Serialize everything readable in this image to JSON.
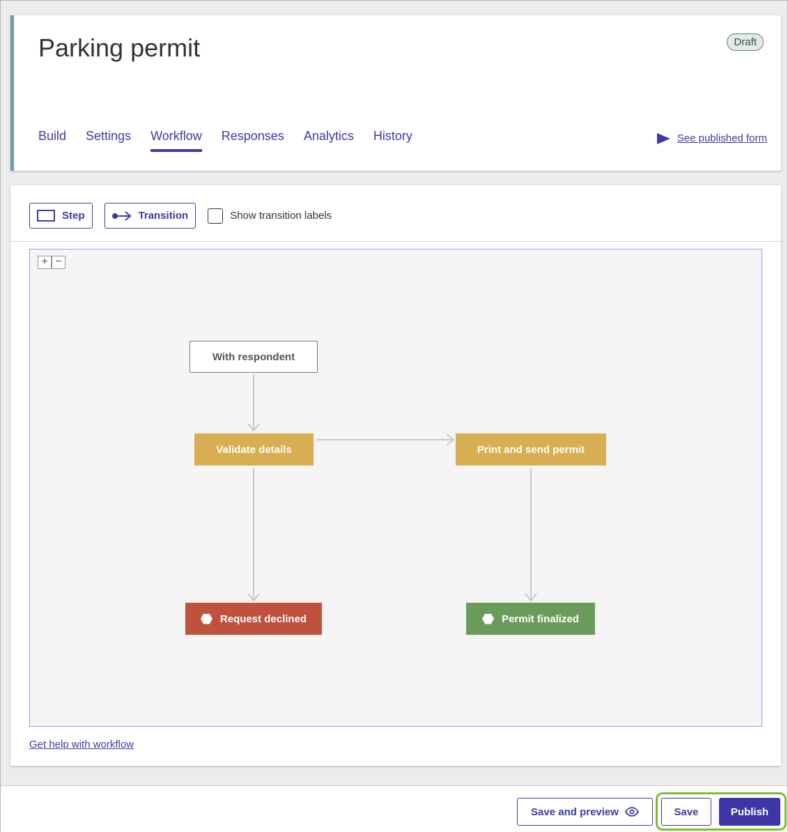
{
  "header": {
    "title": "Parking permit",
    "status": "Draft",
    "tabs": [
      {
        "label": "Build"
      },
      {
        "label": "Settings"
      },
      {
        "label": "Workflow",
        "active": true
      },
      {
        "label": "Responses"
      },
      {
        "label": "Analytics"
      },
      {
        "label": "History"
      }
    ],
    "published_link": "See published form"
  },
  "toolbar": {
    "step_label": "Step",
    "transition_label": "Transition",
    "show_labels_text": "Show transition labels",
    "show_labels_checked": false
  },
  "zoom": {
    "in": "+",
    "out": "−"
  },
  "workflow": {
    "nodes": {
      "start": "With respondent",
      "validate": "Validate details",
      "print": "Print and send permit",
      "declined": "Request declined",
      "finalized": "Permit finalized"
    },
    "colors": {
      "step": "#d8ae52",
      "declined": "#c0513f",
      "finalized": "#6b9b5a"
    }
  },
  "help_link": "Get help with workflow",
  "footer": {
    "save_preview": "Save and preview",
    "save": "Save",
    "publish": "Publish"
  },
  "colors": {
    "accent": "#3d3aa5",
    "highlight": "#7cbf2b"
  }
}
